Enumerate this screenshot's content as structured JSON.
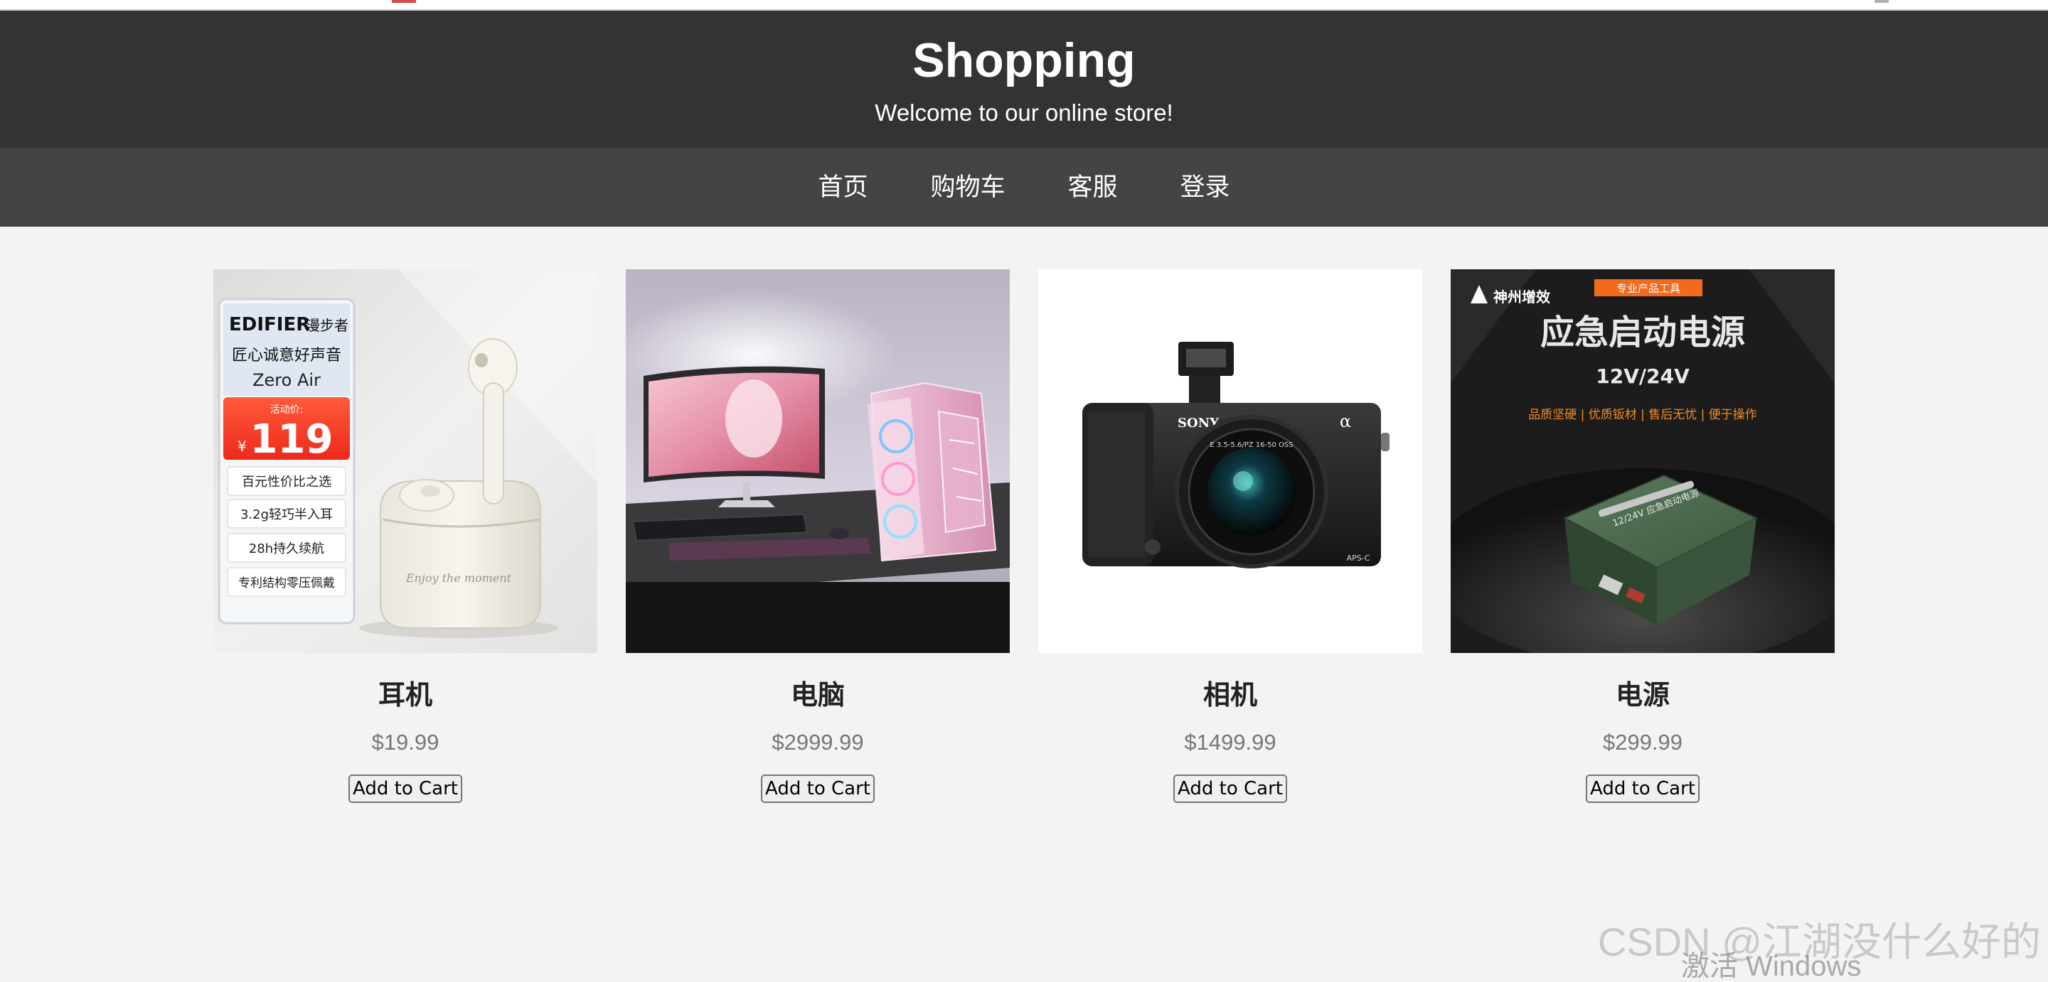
{
  "header": {
    "title": "Shopping",
    "tagline": "Welcome to our online store!"
  },
  "nav": {
    "items": [
      {
        "label": "首页"
      },
      {
        "label": "购物车"
      },
      {
        "label": "客服"
      },
      {
        "label": "登录"
      }
    ]
  },
  "products": [
    {
      "name": "耳机",
      "price": "$19.99",
      "button_label": "Add to Cart",
      "image": {
        "brand": "EDIFIER",
        "brand_cn": "漫步者",
        "slogan": "匠心诚意好声音",
        "model": "Zero Air",
        "promo_label": "活动价:",
        "currency": "¥",
        "promo_price": "119",
        "features": [
          "百元性价比之选",
          "3.2g轻巧半入耳",
          "28h持久续航",
          "专利结构零压佩戴"
        ],
        "case_script": "Enjoy the moment"
      }
    },
    {
      "name": "电脑",
      "price": "$2999.99",
      "button_label": "Add to Cart"
    },
    {
      "name": "相机",
      "price": "$1499.99",
      "button_label": "Add to Cart",
      "image": {
        "brand": "SONY",
        "mark": "α",
        "lens_text": "E 3.5-5.6/PZ 16-50 OSS",
        "sensor": "APS-C"
      }
    },
    {
      "name": "电源",
      "price": "$299.99",
      "button_label": "Add to Cart",
      "image": {
        "logo_text": "神州增效",
        "badge": "专业产品工具",
        "headline": "应急启动电源",
        "voltage": "12V/24V",
        "features": "品质坚硬 | 优质钣材 | 售后无忧 | 便于操作",
        "box_label": "12/24V 应急启动电源"
      }
    }
  ],
  "watermark": "CSDN @江湖没什么好的",
  "os_notice": "激活 Windows",
  "colors": {
    "header_bg": "#333333",
    "nav_bg": "#444444",
    "page_bg": "#f3f3f3",
    "price": "#777777"
  }
}
